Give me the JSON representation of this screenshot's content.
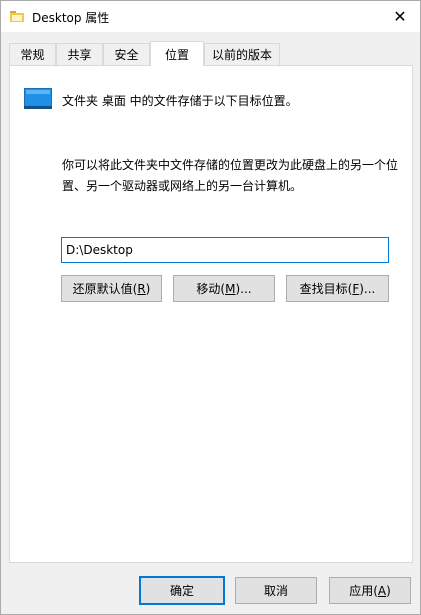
{
  "window": {
    "title": "Desktop 属性",
    "close_glyph": "✕"
  },
  "tabs": [
    {
      "label": "常规"
    },
    {
      "label": "共享"
    },
    {
      "label": "安全"
    },
    {
      "label": "位置"
    },
    {
      "label": "以前的版本"
    }
  ],
  "active_tab": "位置",
  "location": {
    "summary": "文件夹 桌面 中的文件存储于以下目标位置。",
    "description": "你可以将此文件夹中文件存储的位置更改为此硬盘上的另一个位置、另一个驱动器或网络上的另一台计算机。",
    "path_value": "D:\\Desktop",
    "restore_button": {
      "text": "还原默认值(",
      "mnemonic": "R",
      "suffix": ")"
    },
    "move_button": {
      "text": "移动(",
      "mnemonic": "M",
      "suffix": ")..."
    },
    "find_button": {
      "text": "查找目标(",
      "mnemonic": "F",
      "suffix": ")..."
    }
  },
  "footer": {
    "ok_label": "确定",
    "cancel_label": "取消",
    "apply_button": {
      "text": "应用(",
      "mnemonic": "A",
      "suffix": ")"
    }
  },
  "colors": {
    "accent": "#0078d7",
    "folder_yellow": "#f4c64d",
    "drive_blue": "#1e90e6"
  },
  "icons": {
    "title": "folder-icon",
    "location": "drive-icon",
    "close": "close-icon"
  }
}
